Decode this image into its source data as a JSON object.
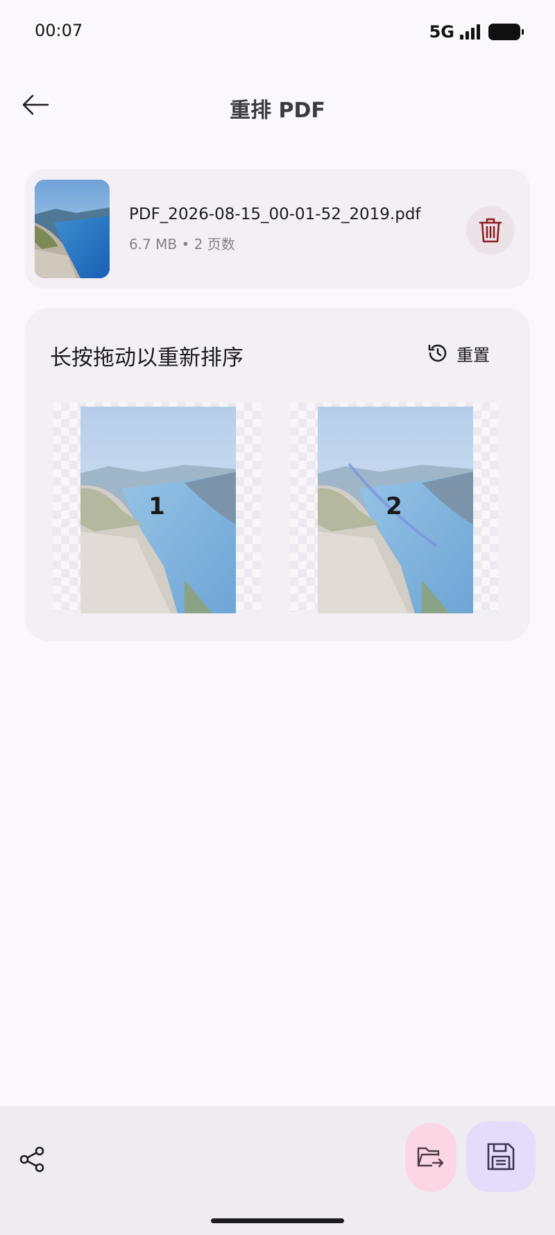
{
  "status_bar": {
    "time": "00:07",
    "network": "5G"
  },
  "header": {
    "title": "重排 PDF",
    "back_icon": "arrow-left-icon"
  },
  "file": {
    "name": "PDF_2026-08-15_00-01-52_2019.pdf",
    "meta": "6.7 MB • 2 页数",
    "delete_icon": "trash-icon",
    "delete_color": "#8c1d25"
  },
  "reorder": {
    "title": "长按拖动以重新排序",
    "reset_label": "重置",
    "reset_icon": "history-icon",
    "pages": [
      {
        "number": "1"
      },
      {
        "number": "2"
      }
    ]
  },
  "bottom_bar": {
    "share_icon": "share-icon",
    "export_icon": "folder-export-icon",
    "save_icon": "save-icon",
    "export_color": "#fdd6e4",
    "save_color": "#e3ddfb"
  }
}
